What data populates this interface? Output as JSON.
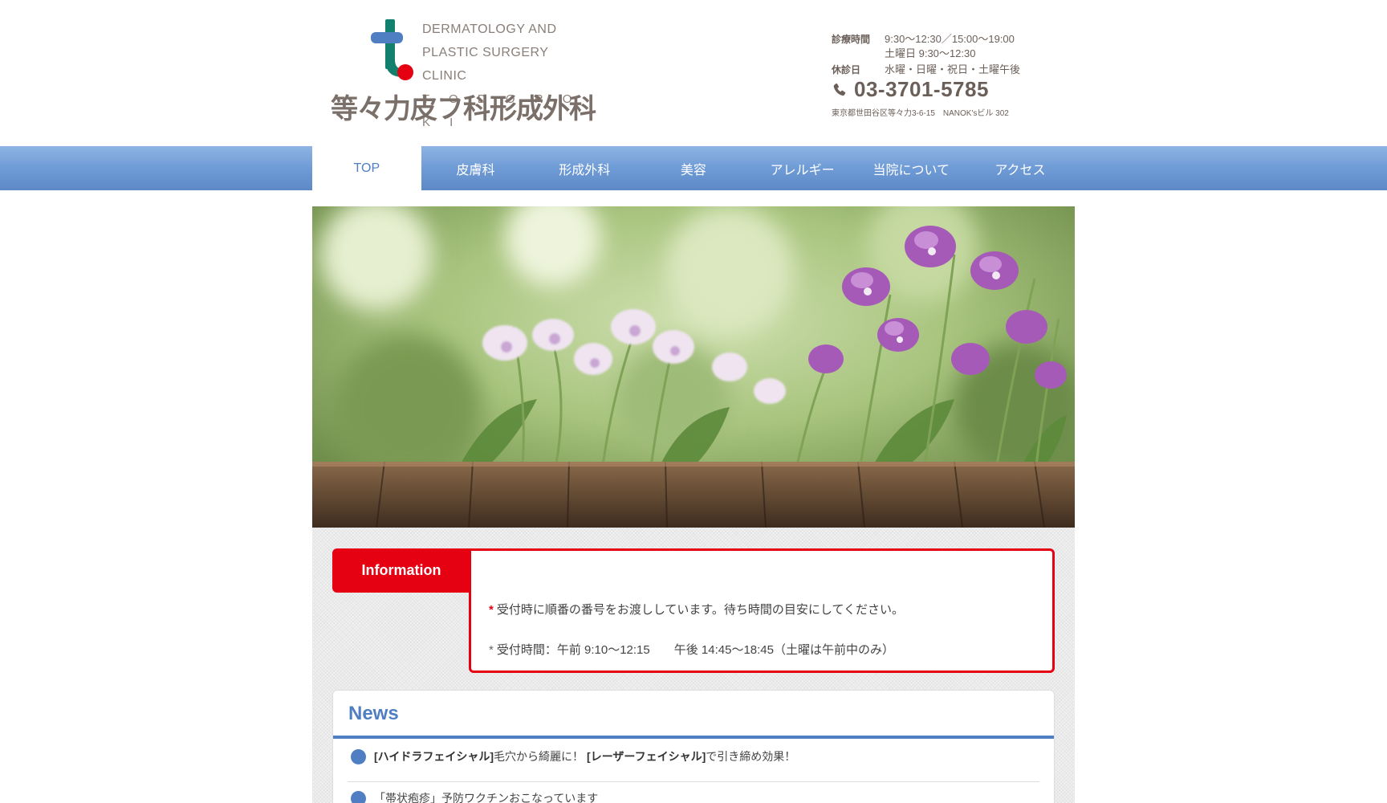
{
  "header": {
    "logo_en_line1": "DERMATOLOGY AND",
    "logo_en_line2": "PLASTIC SURGERY CLINIC",
    "logo_en_line3": "T O D O R O K I",
    "logo_ja": "等々力皮フ科形成外科",
    "hours_label": "診療時間",
    "hours_value1": "9:30～12:30／15:00～19:00",
    "hours_value2": "土曜日 9:30～12:30",
    "closed_label": "休診日",
    "closed_value": "水曜・日曜・祝日・土曜午後",
    "phone": "03-3701-5785",
    "address": "東京都世田谷区等々力3-6-15　NANOK'sビル 302"
  },
  "nav": {
    "items": [
      "TOP",
      "皮膚科",
      "形成外科",
      "美容",
      "アレルギー",
      "当院について",
      "アクセス"
    ],
    "active_index": 0
  },
  "information": {
    "tab_label": "Information",
    "line1_mark": "*",
    "line1_text": "受付時に順番の番号をお渡ししています。待ち時間の目安にしてください。",
    "line2_mark": "*",
    "line2_text": "受付時間：午前 9:10〜12:15　　午後 14:45〜18:45（土曜は午前中のみ）"
  },
  "news": {
    "title": "News",
    "item1_part1": "[ハイドラフェイシャル]",
    "item1_part2": "毛穴から綺麗に！",
    "item1_part3": "[レーザーフェイシャル]",
    "item1_part4": "で引き締め効果！",
    "item2_text": "「帯状疱疹」予防ワクチンおこなっています"
  },
  "colors": {
    "brand_blue": "#4f7fc2",
    "accent_red": "#e50012",
    "text_brown": "#6b5f59"
  }
}
